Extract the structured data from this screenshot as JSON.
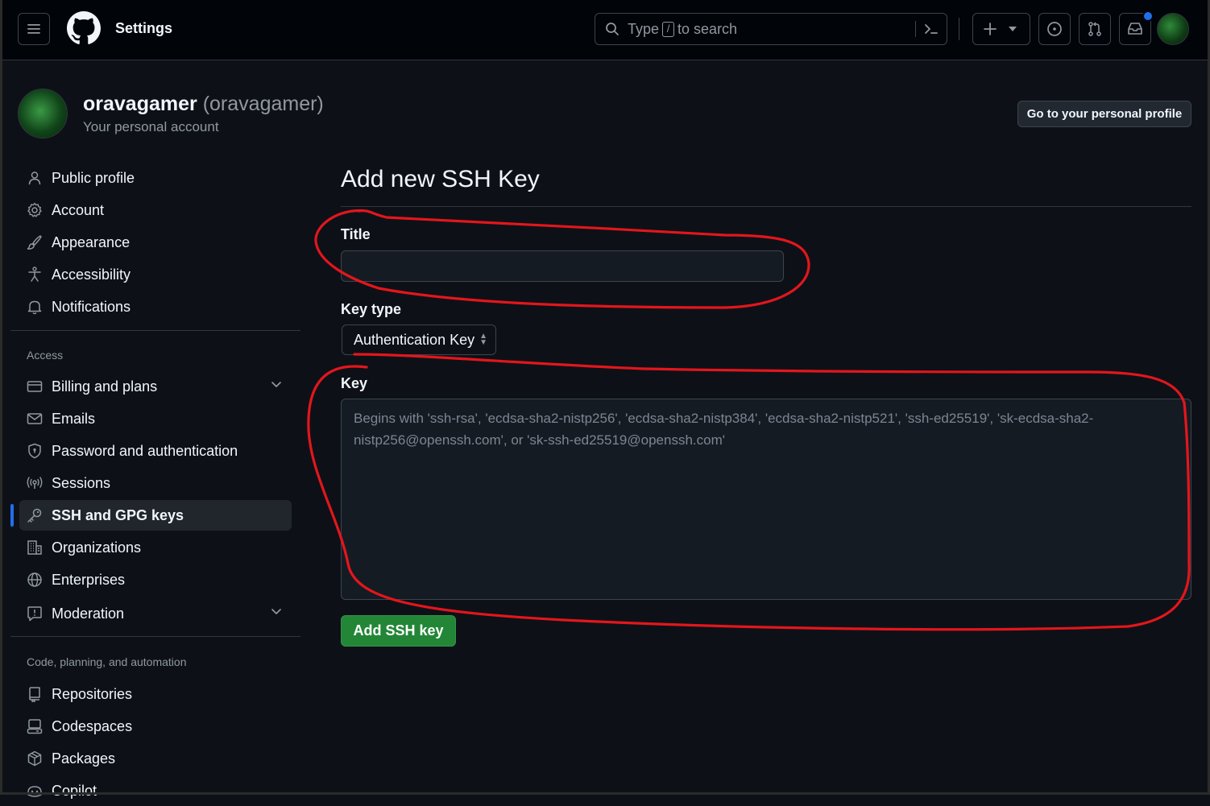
{
  "header": {
    "title": "Settings",
    "search_prefix": "Type",
    "search_key": "/",
    "search_suffix": "to search",
    "icons": [
      "menu-icon",
      "github-logo-icon",
      "search-icon",
      "command-palette-icon",
      "plus-icon",
      "triangle-down-icon",
      "issue-opened-icon",
      "pull-request-icon",
      "inbox-icon"
    ]
  },
  "profile": {
    "name": "oravagamer",
    "login": "(oravagamer)",
    "subtitle": "Your personal account",
    "profile_button": "Go to your personal profile"
  },
  "sidebar": {
    "items": [
      {
        "label": "Public profile",
        "icon": "person-icon"
      },
      {
        "label": "Account",
        "icon": "gear-icon"
      },
      {
        "label": "Appearance",
        "icon": "paintbrush-icon"
      },
      {
        "label": "Accessibility",
        "icon": "accessibility-icon"
      },
      {
        "label": "Notifications",
        "icon": "bell-icon"
      }
    ],
    "access_heading": "Access",
    "access_items": [
      {
        "label": "Billing and plans",
        "icon": "credit-card-icon"
      },
      {
        "label": "Emails",
        "icon": "mail-icon"
      },
      {
        "label": "Password and authentication",
        "icon": "shield-icon"
      },
      {
        "label": "Sessions",
        "icon": "broadcast-icon"
      },
      {
        "label": "SSH and GPG keys",
        "icon": "key-icon",
        "active": true
      },
      {
        "label": "Organizations",
        "icon": "organization-icon"
      },
      {
        "label": "Enterprises",
        "icon": "globe-icon"
      },
      {
        "label": "Moderation",
        "icon": "report-icon"
      }
    ],
    "code_heading": "Code, planning, and automation",
    "code_items": [
      {
        "label": "Repositories",
        "icon": "repo-icon"
      },
      {
        "label": "Codespaces",
        "icon": "codespaces-icon"
      },
      {
        "label": "Packages",
        "icon": "package-icon"
      },
      {
        "label": "Copilot",
        "icon": "copilot-icon"
      }
    ]
  },
  "main": {
    "heading": "Add new SSH Key",
    "title_label": "Title",
    "title_value": "",
    "key_type_label": "Key type",
    "key_type_value": "Authentication Key",
    "key_label": "Key",
    "key_placeholder": "Begins with 'ssh-rsa', 'ecdsa-sha2-nistp256', 'ecdsa-sha2-nistp384', 'ecdsa-sha2-nistp521', 'ssh-ed25519', 'sk-ecdsa-sha2-nistp256@openssh.com', or 'sk-ssh-ed25519@openssh.com'",
    "submit_label": "Add SSH key"
  },
  "colors": {
    "background": "#0d1117",
    "header_background": "#010409",
    "accent_blue": "#1f6feb",
    "button_green": "#238636",
    "annotation_red": "#e3161c"
  }
}
